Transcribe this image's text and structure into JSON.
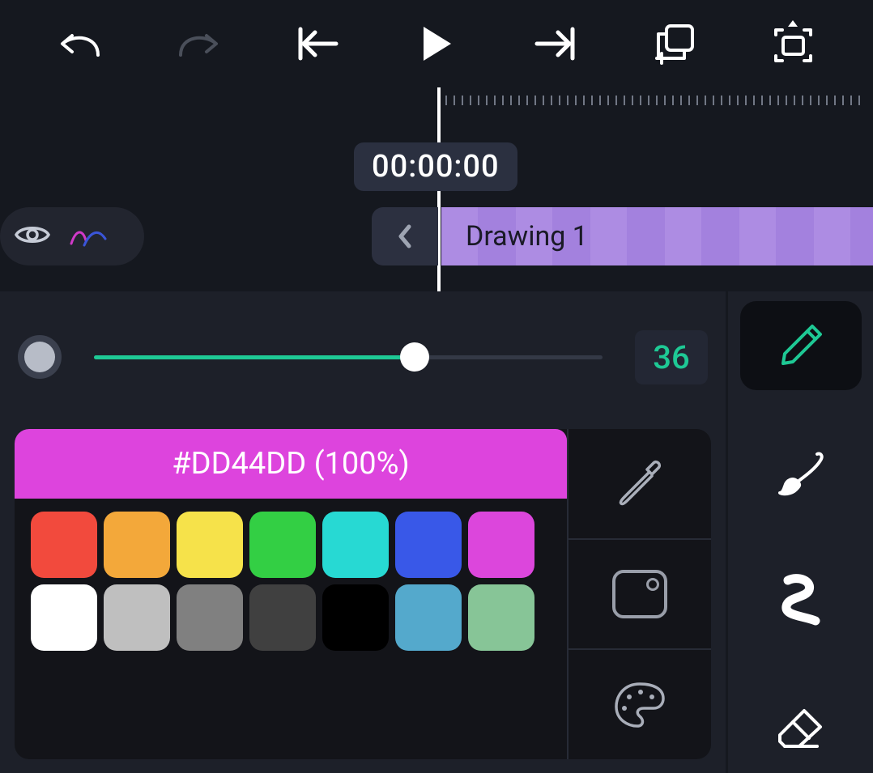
{
  "toolbar": {
    "undo_enabled": true,
    "redo_enabled": false
  },
  "timeline": {
    "timecode": "00:00:00",
    "clip_label": "Drawing 1"
  },
  "brush": {
    "size": "36",
    "slider_percent": 63
  },
  "color": {
    "current_hex": "#DD44DD",
    "current_opacity": "100%",
    "hero_label": "#DD44DD (100%)",
    "hero_bg": "#DD44DD",
    "swatches": [
      "#f24a3d",
      "#f3a83a",
      "#f6e24a",
      "#33cf44",
      "#27d9d3",
      "#3958e8",
      "#dc46dc",
      "#ffffff",
      "#bfbfbf",
      "#808080",
      "#404040",
      "#000000",
      "#54a9cc",
      "#87c597"
    ]
  },
  "tools": {
    "active": "pencil",
    "list": [
      "pencil",
      "brush",
      "squiggle",
      "eraser"
    ]
  }
}
